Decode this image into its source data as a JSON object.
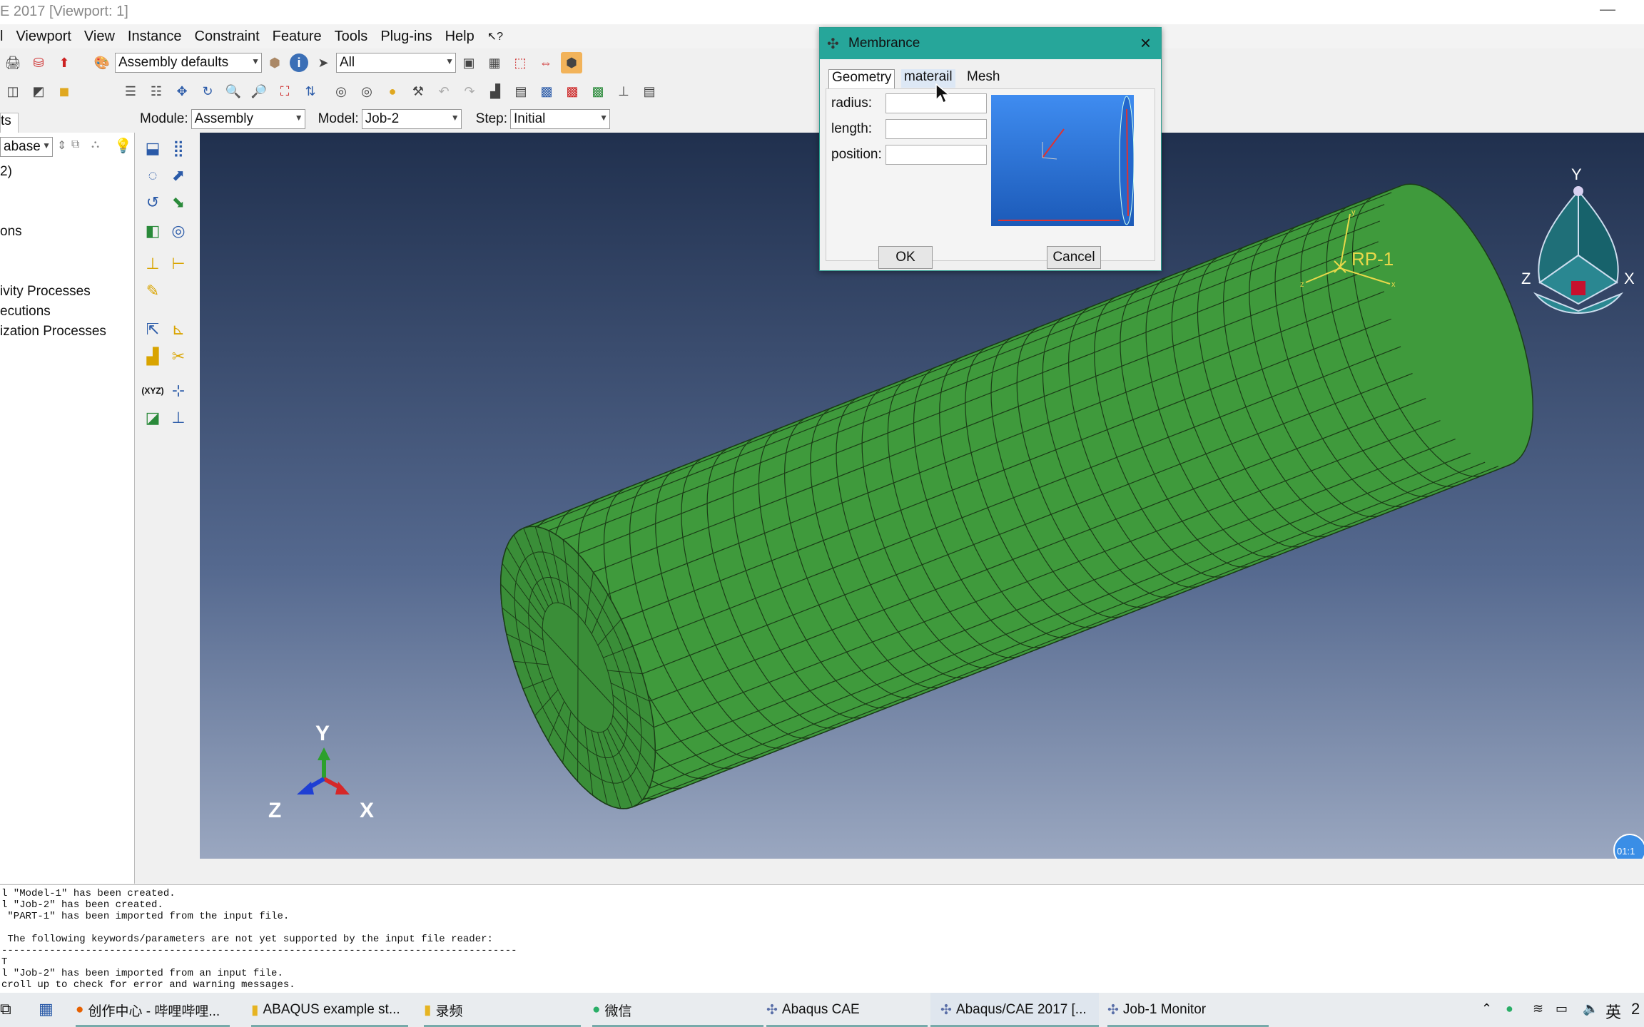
{
  "window": {
    "title": "E 2017 [Viewport: 1]",
    "minimize": "—"
  },
  "menu": [
    "l",
    "Viewport",
    "View",
    "Instance",
    "Constraint",
    "Feature",
    "Tools",
    "Plug-ins",
    "Help"
  ],
  "toolbar": {
    "assembly_defaults": "Assembly defaults",
    "selection_filter": "All",
    "module_label": "Module:",
    "module_value": "Assembly",
    "model_label": "Model:",
    "model_value": "Job-2",
    "step_label": "Step:",
    "step_value": "Initial"
  },
  "tree": {
    "tab": "ts",
    "combo": "abase",
    "rows": [
      "2)",
      "ons",
      "ivity Processes",
      "ecutions",
      "ization Processes"
    ]
  },
  "viewport": {
    "rp_label": "RP-1",
    "triad": {
      "y": "Y",
      "z": "Z",
      "x": "X"
    },
    "view_cube": {
      "y": "Y",
      "z": "Z",
      "x": "X"
    },
    "timer": "01:1",
    "colors": {
      "mesh": "#3f9a3c",
      "edge": "#1b3d17"
    }
  },
  "dialog": {
    "title": "Membrance",
    "tabs": [
      "Geometry",
      "materail",
      "Mesh"
    ],
    "fields": [
      {
        "label": "radius:",
        "value": ""
      },
      {
        "label": "length:",
        "value": ""
      },
      {
        "label": "position:",
        "value": ""
      }
    ],
    "ok": "OK",
    "cancel": "Cancel"
  },
  "messages": [
    "l \"Model-1\" has been created.",
    "l \"Job-2\" has been created.",
    " \"PART-1\" has been imported from the input file.",
    "",
    " The following keywords/parameters are not yet supported by the input file reader:",
    "--------------------------------------------------------------------------------------",
    "T",
    "l \"Job-2\" has been imported from an input file.",
    "croll up to check for error and warning messages."
  ],
  "taskbar": {
    "items": [
      "创作中心 - 哔哩哔哩...",
      "ABAQUS example st...",
      "录频",
      "微信",
      "Abaqus CAE",
      "Abaqus/CAE 2017 [...",
      "Job-1 Monitor"
    ],
    "tray_lang": "英",
    "tray_time": "2"
  }
}
